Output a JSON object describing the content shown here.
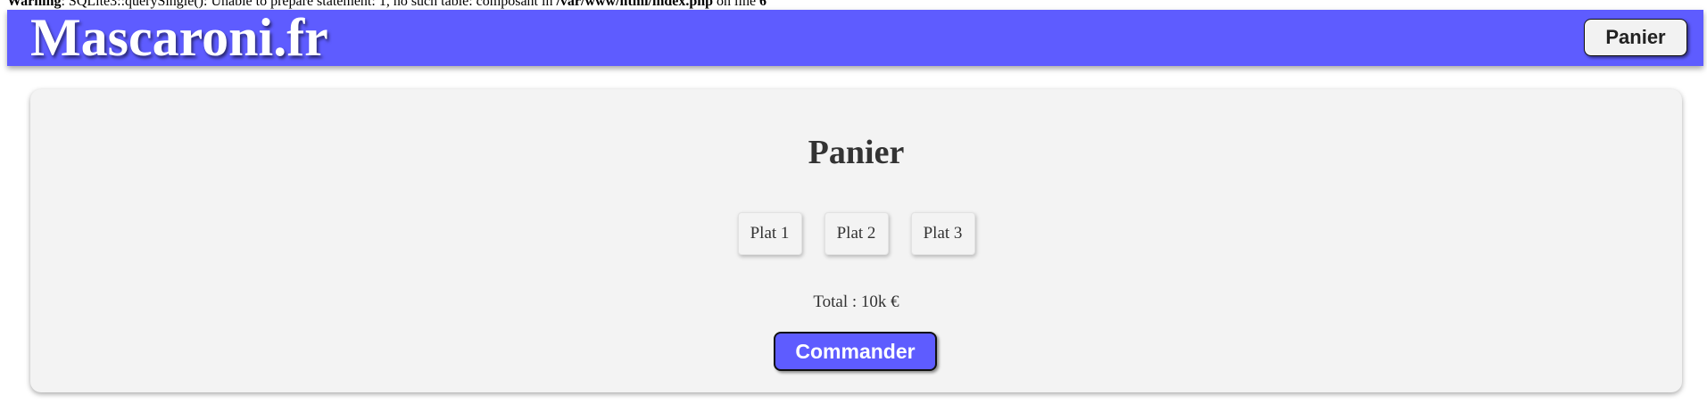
{
  "warning": {
    "label": "Warning",
    "message": ": SQLite3::querySingle(): Unable to prepare statement: 1, no such table: composant in ",
    "path": "/var/www/html/index.php",
    "line_text": " on line ",
    "line_number": "6"
  },
  "header": {
    "logo": "Mascaroni.fr",
    "cart_button": "Panier",
    "brand_color": "#5e5cff"
  },
  "cart": {
    "title": "Panier",
    "items": [
      "Plat 1",
      "Plat 2",
      "Plat 3"
    ],
    "total": "Total : 10k €",
    "order_button": "Commander"
  }
}
